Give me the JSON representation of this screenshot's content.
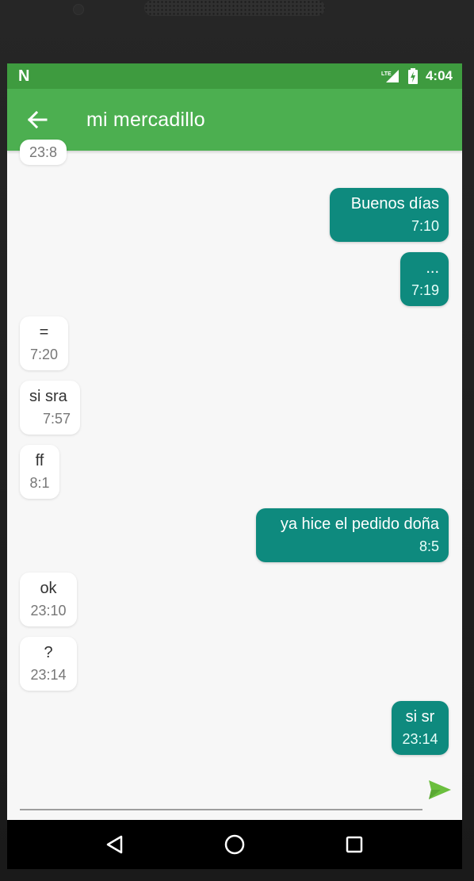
{
  "status_bar": {
    "left_label": "N",
    "network": "LTE",
    "time": "4:04"
  },
  "app_bar": {
    "title": "mi mercadillo",
    "back_icon": "arrow-left-icon"
  },
  "messages": [
    {
      "dir": "in",
      "text": "",
      "time": "23:8"
    },
    {
      "dir": "out",
      "text": "Buenos días",
      "time": "7:10"
    },
    {
      "dir": "out",
      "text": "...",
      "time": "7:19"
    },
    {
      "dir": "in",
      "text": "=",
      "time": "7:20"
    },
    {
      "dir": "in",
      "text": "si sra",
      "time": "7:57"
    },
    {
      "dir": "in",
      "text": "ff",
      "time": "8:1"
    },
    {
      "dir": "out",
      "text": "ya hice el pedido doña",
      "time": "8:5"
    },
    {
      "dir": "in",
      "text": "ok",
      "time": "23:10"
    },
    {
      "dir": "in",
      "text": "?",
      "time": "23:14"
    },
    {
      "dir": "out",
      "text": "si sr",
      "time": "23:14"
    }
  ],
  "input": {
    "value": "",
    "send_icon": "send-icon"
  },
  "colors": {
    "status_bar": "#3e9b3f",
    "app_bar": "#4caf50",
    "outgoing_bubble": "#0e8a7e",
    "incoming_bubble": "#ffffff",
    "send_icon": "#6bbf3e"
  },
  "nav_bar": {
    "back": "back-triangle-icon",
    "home": "home-circle-icon",
    "recents": "recents-square-icon"
  }
}
